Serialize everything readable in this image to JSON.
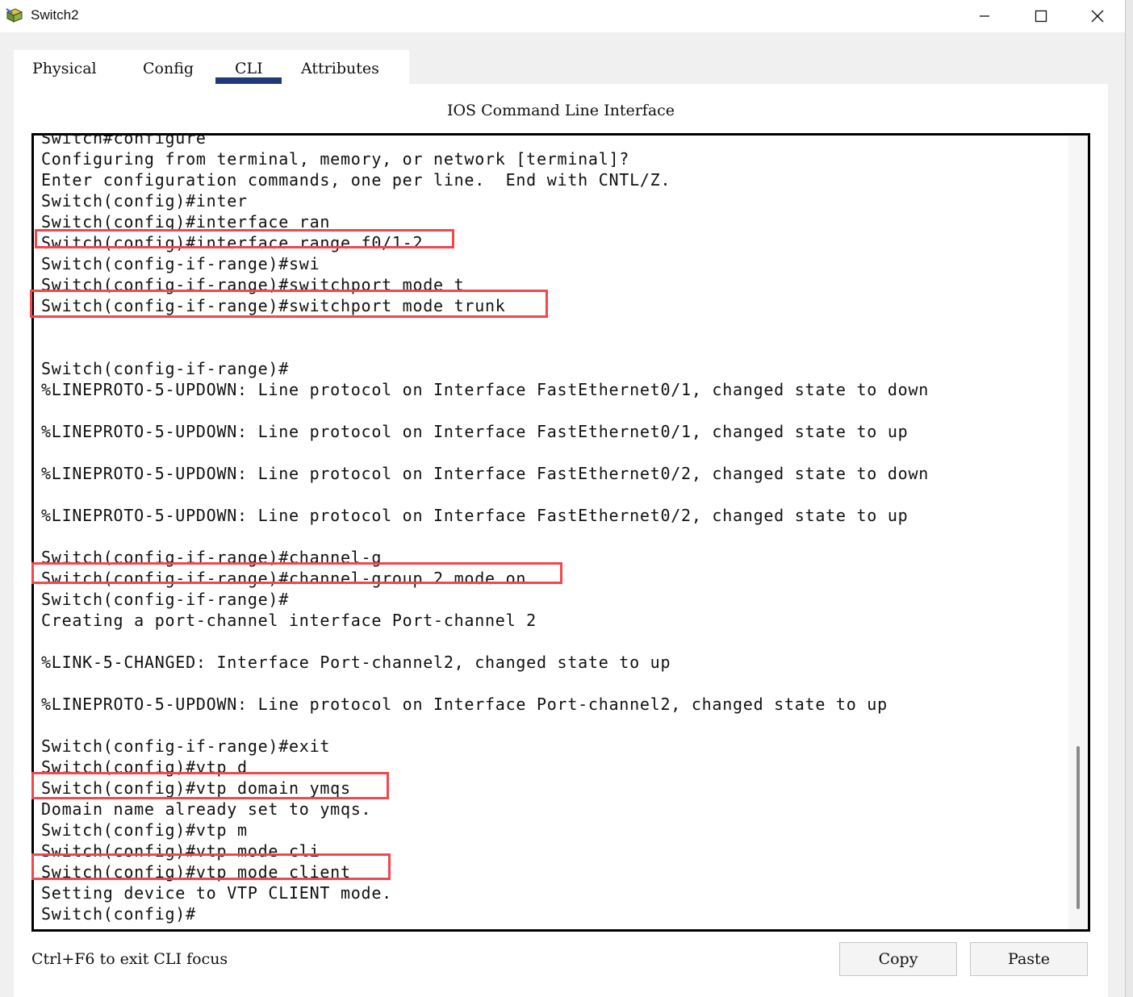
{
  "window": {
    "title": "Switch2",
    "icon": "cisco-device-icon"
  },
  "window_controls": {
    "minimize": "minimize-icon",
    "maximize": "maximize-icon",
    "close": "close-icon"
  },
  "tabs": [
    {
      "label": "Physical"
    },
    {
      "label": "Config"
    },
    {
      "label": "CLI",
      "selected": true
    },
    {
      "label": "Attributes"
    }
  ],
  "cli": {
    "heading": "IOS Command Line Interface",
    "lines": [
      "Switch#configure",
      "Configuring from terminal, memory, or network [terminal]?",
      "Enter configuration commands, one per line.  End with CNTL/Z.",
      "Switch(config)#inter",
      "Switch(config)#interface ran",
      "Switch(config)#interface range f0/1-2",
      "Switch(config-if-range)#swi",
      "Switch(config-if-range)#switchport mode t",
      "Switch(config-if-range)#switchport mode trunk",
      "",
      "",
      "Switch(config-if-range)#",
      "%LINEPROTO-5-UPDOWN: Line protocol on Interface FastEthernet0/1, changed state to down",
      "",
      "%LINEPROTO-5-UPDOWN: Line protocol on Interface FastEthernet0/1, changed state to up",
      "",
      "%LINEPROTO-5-UPDOWN: Line protocol on Interface FastEthernet0/2, changed state to down",
      "",
      "%LINEPROTO-5-UPDOWN: Line protocol on Interface FastEthernet0/2, changed state to up",
      "",
      "Switch(config-if-range)#channel-g",
      "Switch(config-if-range)#channel-group 2 mode on",
      "Switch(config-if-range)#",
      "Creating a port-channel interface Port-channel 2",
      "",
      "%LINK-5-CHANGED: Interface Port-channel2, changed state to up",
      "",
      "%LINEPROTO-5-UPDOWN: Line protocol on Interface Port-channel2, changed state to up",
      "",
      "Switch(config-if-range)#exit",
      "Switch(config)#vtp d",
      "Switch(config)#vtp domain ymqs",
      "Domain name already set to ymqs.",
      "Switch(config)#vtp m",
      "Switch(config)#vtp mode cli",
      "Switch(config)#vtp mode client",
      "Setting device to VTP CLIENT mode.",
      "Switch(config)#"
    ]
  },
  "annotations": {
    "highlight_color": "#f0484f"
  },
  "footer": {
    "hint": "Ctrl+F6 to exit CLI focus",
    "copy_label": "Copy",
    "paste_label": "Paste"
  }
}
